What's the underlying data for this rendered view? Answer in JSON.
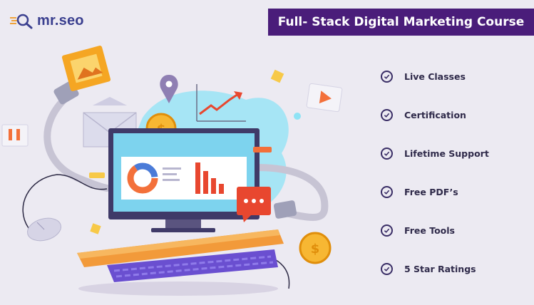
{
  "logo": {
    "text": "mr.seo",
    "icon": "magnifier-icon"
  },
  "title": "Full- Stack Digital Marketing Course",
  "features": [
    {
      "label": "Live Classes",
      "icon": "check-circle-icon"
    },
    {
      "label": "Certification",
      "icon": "check-circle-icon"
    },
    {
      "label": "Lifetime Support",
      "icon": "check-circle-icon"
    },
    {
      "label": "Free PDF’s",
      "icon": "check-circle-icon"
    },
    {
      "label": "Free Tools",
      "icon": "check-circle-icon"
    },
    {
      "label": "5 Star Ratings",
      "icon": "check-circle-icon"
    }
  ],
  "colors": {
    "banner": "#4a1d7a",
    "background": "#eceaf2",
    "accent_orange": "#f3703a",
    "accent_yellow": "#f7c948",
    "accent_cyan": "#5fd3ef"
  }
}
